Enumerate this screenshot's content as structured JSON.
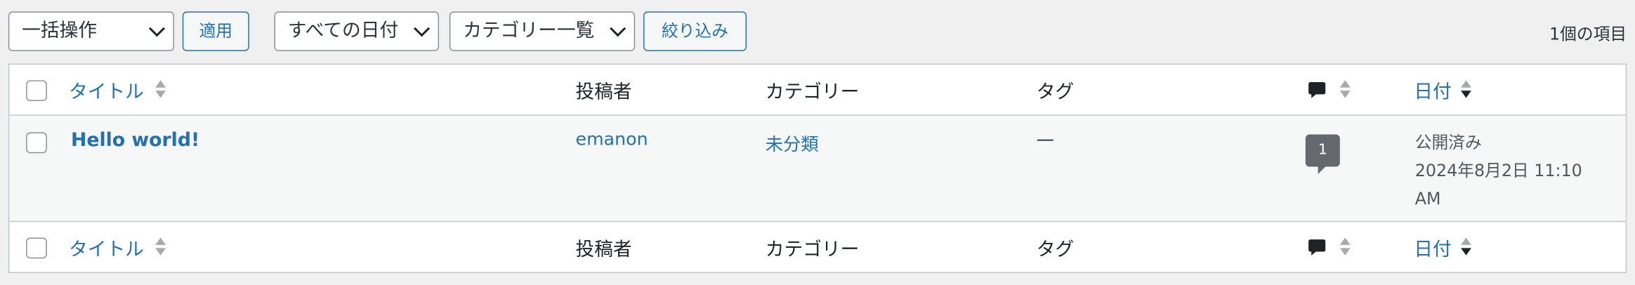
{
  "toolbar": {
    "bulk_action": "一括操作",
    "apply": "適用",
    "date_filter": "すべての日付",
    "category_filter": "カテゴリー一覧",
    "filter": "絞り込み",
    "item_count": "1個の項目"
  },
  "table": {
    "headers": {
      "title": "タイトル",
      "author": "投稿者",
      "category": "カテゴリー",
      "tags": "タグ",
      "date": "日付"
    },
    "rows": [
      {
        "title": "Hello world!",
        "author": "emanon",
        "category": "未分類",
        "tags": "—",
        "comments": "1",
        "status": "公開済み",
        "date_line1": "2024年8月2日 11:10",
        "date_line2": "AM"
      }
    ]
  },
  "icons": {
    "comment": "comment-icon",
    "sort": "sort-arrows-icon",
    "chevron": "chevron-down-icon"
  },
  "colors": {
    "link": "#2271b1",
    "background": "#f0f0f1",
    "row_alt": "#f6f7f7",
    "badge": "#646970"
  }
}
